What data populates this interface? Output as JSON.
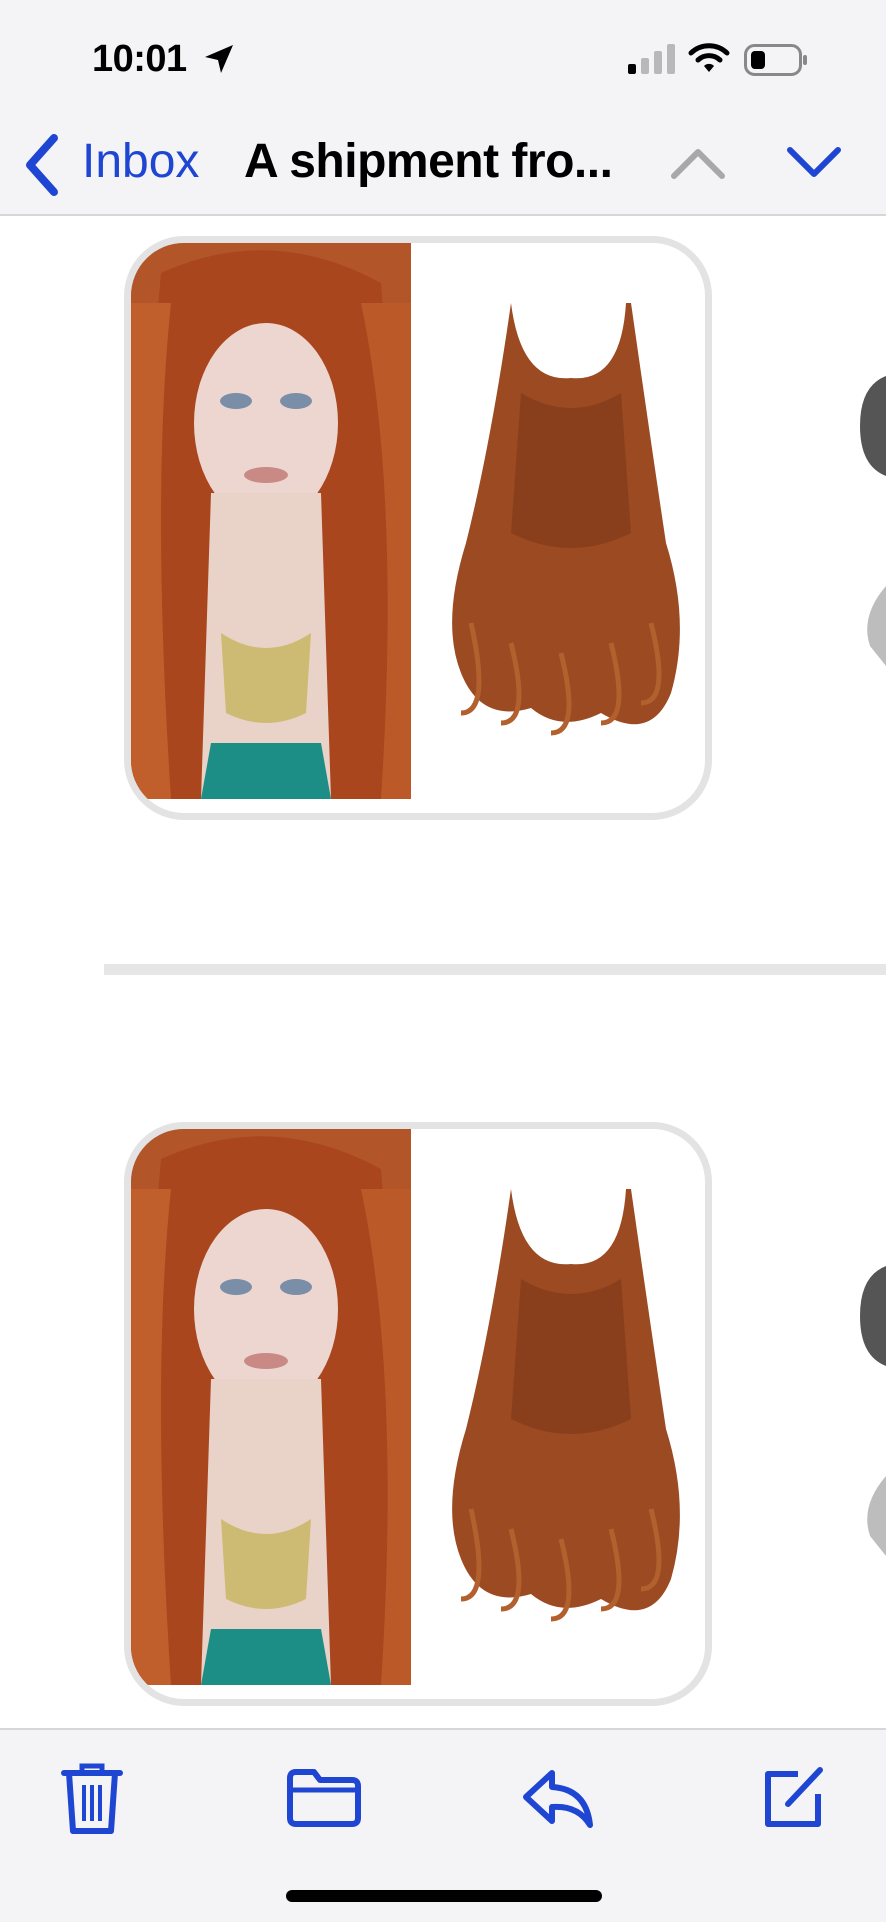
{
  "status_bar": {
    "time": "10:01",
    "icons": [
      "location-arrow-icon",
      "cellular-signal-icon",
      "wifi-icon",
      "battery-icon"
    ]
  },
  "nav": {
    "back_label": "Inbox",
    "title": "A shipment fro...",
    "icons": [
      "back-chevron-icon",
      "previous-message-icon",
      "next-message-icon"
    ]
  },
  "email_body": {
    "products": [
      {
        "image": "red-hair-model-and-wavy-hair-extension"
      },
      {
        "image": "red-hair-model-and-wavy-hair-extension"
      }
    ]
  },
  "toolbar": {
    "icons": [
      "trash-icon",
      "folder-icon",
      "reply-icon",
      "compose-icon"
    ]
  },
  "colors": {
    "accent": "#1e46d2",
    "bar_background": "#f4f4f6",
    "divider": "#e6e6e6"
  }
}
